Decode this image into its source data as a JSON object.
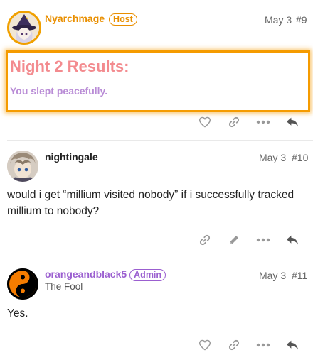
{
  "posts": [
    {
      "username": "Nyarchmage",
      "badge": "Host",
      "date": "May 3",
      "number": "#9",
      "results_title": "Night 2 Results:",
      "results_sub": "You slept peacefully.",
      "actions": [
        "heart-icon",
        "link-icon",
        "more-icon",
        "reply-icon"
      ]
    },
    {
      "username": "nightingale",
      "date": "May 3",
      "number": "#10",
      "body": "would i get “millium visited nobody” if i successfully tracked millium to nobody?",
      "actions": [
        "link-icon",
        "edit-icon",
        "more-icon",
        "reply-icon"
      ]
    },
    {
      "username": "orangeandblack5",
      "badge": "Admin",
      "title": "The Fool",
      "date": "May 3",
      "number": "#11",
      "body": "Yes.",
      "actions": [
        "heart-icon",
        "link-icon",
        "more-icon",
        "reply-icon"
      ]
    }
  ],
  "colors": {
    "host": "#e98f00",
    "admin": "#9b5fd0",
    "results_title": "#f38b8f",
    "results_sub": "#b98cd6",
    "highlight_border": "#f59b00",
    "icon": "#999999"
  }
}
